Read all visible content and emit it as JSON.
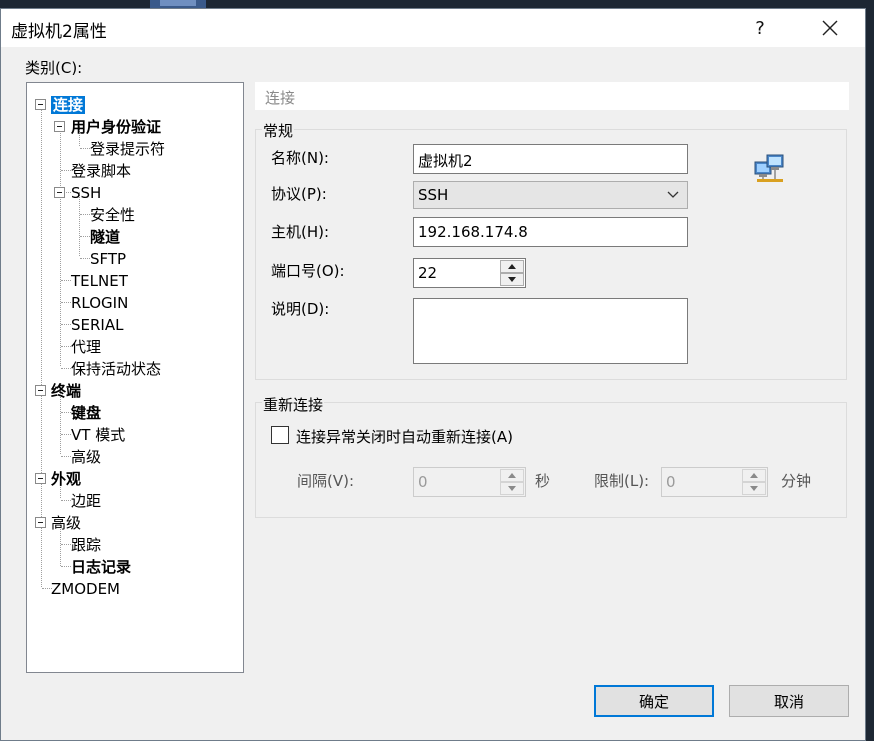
{
  "window": {
    "title": "虚拟机2属性",
    "help": "?"
  },
  "categories": {
    "label": "类别(C):",
    "items": [
      {
        "label": "连接",
        "level": 0,
        "bold": true,
        "selected": true
      },
      {
        "label": "用户身份验证",
        "level": 1,
        "bold": true
      },
      {
        "label": "登录提示符",
        "level": 2
      },
      {
        "label": "登录脚本",
        "level": 1
      },
      {
        "label": "SSH",
        "level": 1
      },
      {
        "label": "安全性",
        "level": 2
      },
      {
        "label": "隧道",
        "level": 2,
        "bold": true
      },
      {
        "label": "SFTP",
        "level": 2
      },
      {
        "label": "TELNET",
        "level": 1
      },
      {
        "label": "RLOGIN",
        "level": 1
      },
      {
        "label": "SERIAL",
        "level": 1
      },
      {
        "label": "代理",
        "level": 1
      },
      {
        "label": "保持活动状态",
        "level": 1
      },
      {
        "label": "终端",
        "level": 0,
        "bold": true
      },
      {
        "label": "键盘",
        "level": 1,
        "bold": true
      },
      {
        "label": "VT 模式",
        "level": 1
      },
      {
        "label": "高级",
        "level": 1
      },
      {
        "label": "外观",
        "level": 0,
        "bold": true
      },
      {
        "label": "边距",
        "level": 1
      },
      {
        "label": "高级",
        "level": 0
      },
      {
        "label": "跟踪",
        "level": 1
      },
      {
        "label": "日志记录",
        "level": 1,
        "bold": true
      },
      {
        "label": "ZMODEM",
        "level": 0
      }
    ]
  },
  "panel": {
    "header": "连接",
    "general": {
      "legend": "常规",
      "name_label": "名称(N):",
      "name_value": "虚拟机2",
      "protocol_label": "协议(P):",
      "protocol_value": "SSH",
      "host_label": "主机(H):",
      "host_value": "192.168.174.8",
      "port_label": "端口号(O):",
      "port_value": "22",
      "desc_label": "说明(D):",
      "desc_value": ""
    },
    "reconnect": {
      "legend": "重新连接",
      "checkbox_label": "连接异常关闭时自动重新连接(A)",
      "checked": false,
      "interval_label": "间隔(V):",
      "interval_value": "0",
      "interval_unit": "秒",
      "limit_label": "限制(L):",
      "limit_value": "0",
      "limit_unit": "分钟"
    }
  },
  "buttons": {
    "ok": "确定",
    "cancel": "取消"
  },
  "colors": {
    "accent": "#0078d7",
    "dialog_bg": "#f0f0f0"
  }
}
